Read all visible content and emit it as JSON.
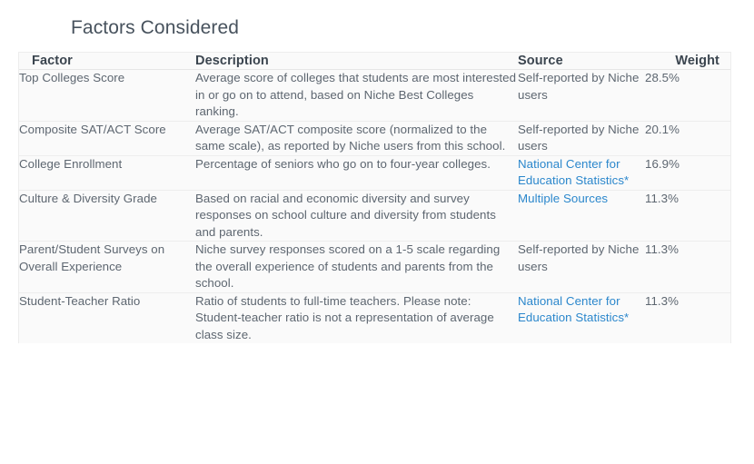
{
  "page": {
    "title": "Factors Considered",
    "link_color": "#2b87cc",
    "text_color": "#5d6670",
    "table_bg": "#fafafa",
    "page_bg": "#ffffff"
  },
  "table": {
    "columns": [
      {
        "key": "factor",
        "label": "Factor"
      },
      {
        "key": "description",
        "label": "Description"
      },
      {
        "key": "source",
        "label": "Source"
      },
      {
        "key": "weight",
        "label": "Weight"
      }
    ],
    "rows": [
      {
        "factor": "Top Colleges Score",
        "description": "Average score of colleges that students are most interested in or go on to attend, based on Niche Best Colleges ranking.",
        "source": "Self-reported by Niche users",
        "source_is_link": false,
        "weight": "28.5%"
      },
      {
        "factor": "Composite SAT/ACT Score",
        "description": "Average SAT/ACT composite score (normalized to the same scale), as reported by Niche users from this school.",
        "source": "Self-reported by Niche users",
        "source_is_link": false,
        "weight": "20.1%"
      },
      {
        "factor": "College Enrollment",
        "description": "Percentage of seniors who go on to four-year colleges.",
        "source": "National Center for Education Statistics*",
        "source_is_link": true,
        "weight": "16.9%"
      },
      {
        "factor": "Culture & Diversity Grade",
        "description": "Based on racial and economic diversity and survey responses on school culture and diversity from students and parents.",
        "source": "Multiple Sources",
        "source_is_link": true,
        "weight": "11.3%"
      },
      {
        "factor": "Parent/Student Surveys on Overall Experience",
        "description": "Niche survey responses scored on a 1-5 scale regarding the overall experience of students and parents from the school.",
        "source": "Self-reported by Niche users",
        "source_is_link": false,
        "weight": "11.3%"
      },
      {
        "factor": "Student-Teacher Ratio",
        "description": "Ratio of students to full-time teachers. Please note: Student-teacher ratio is not a representation of average class size.",
        "source": "National Center for Education Statistics*",
        "source_is_link": true,
        "weight": "11.3%"
      }
    ]
  }
}
